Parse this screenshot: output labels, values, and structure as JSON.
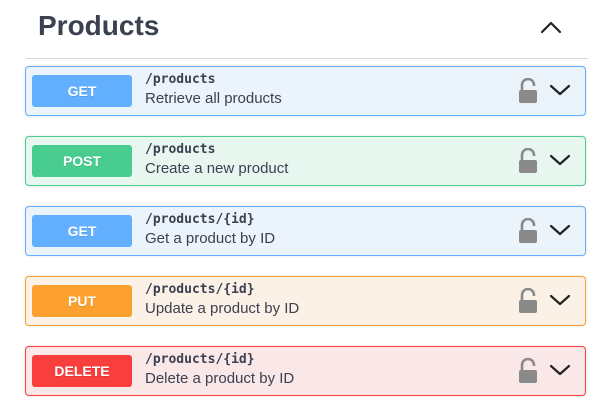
{
  "tag": {
    "title": "Products"
  },
  "operations": [
    {
      "method": "GET",
      "kind": "get",
      "path": "/products",
      "summary": "Retrieve all products"
    },
    {
      "method": "POST",
      "kind": "post",
      "path": "/products",
      "summary": "Create a new product"
    },
    {
      "method": "GET",
      "kind": "get",
      "path": "/products/{id}",
      "summary": "Get a product by ID"
    },
    {
      "method": "PUT",
      "kind": "put",
      "path": "/products/{id}",
      "summary": "Update a product by ID"
    },
    {
      "method": "DELETE",
      "kind": "delete",
      "path": "/products/{id}",
      "summary": "Delete a product by ID"
    }
  ],
  "colors": {
    "get": "#61affe",
    "post": "#49cc90",
    "put": "#fca130",
    "delete": "#f93e3e",
    "text": "#3b4151"
  },
  "icons": {
    "collapse": "chevron-up-icon",
    "lock": "lock-icon",
    "expand": "chevron-down-icon"
  }
}
